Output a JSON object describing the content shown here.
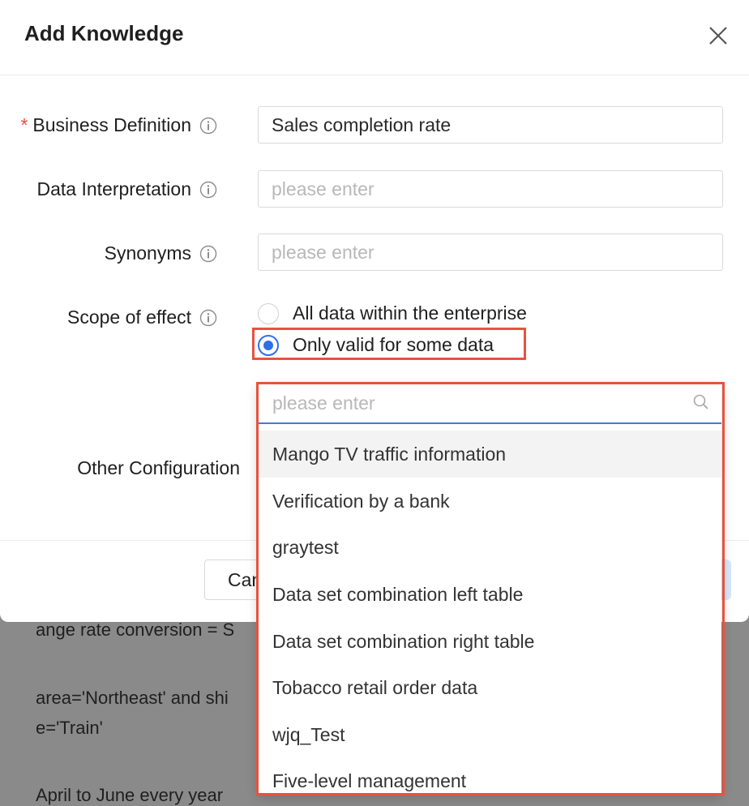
{
  "modal": {
    "title": "Add Knowledge",
    "close_icon": "close-icon"
  },
  "form": {
    "business_definition": {
      "label": "Business Definition",
      "required": true,
      "required_mark": "*",
      "value": "Sales completion rate"
    },
    "data_interpretation": {
      "label": "Data Interpretation",
      "placeholder": "please enter",
      "value": ""
    },
    "synonyms": {
      "label": "Synonyms",
      "placeholder": "please enter",
      "value": ""
    },
    "scope_of_effect": {
      "label": "Scope of effect",
      "options": [
        {
          "label": "All data within the enterprise",
          "checked": false
        },
        {
          "label": "Only valid for some data",
          "checked": true
        }
      ]
    },
    "other_configuration": {
      "label": "Other Configuration"
    }
  },
  "dataset_dropdown": {
    "search_placeholder": "please enter",
    "items": [
      "Mango TV traffic information",
      "Verification by a bank",
      "graytest",
      "Data set combination left table",
      "Data set combination right table",
      "Tobacco retail order data",
      "wjq_Test",
      "Five-level management"
    ],
    "active_index": 0
  },
  "footer": {
    "cancel_label": "Can"
  },
  "background_text": {
    "line1": "ange rate conversion = S",
    "line2": "area='Northeast' and shi",
    "line3": "e='Train'",
    "line4": "April to June every year"
  },
  "colors": {
    "accent": "#2f6fe8",
    "required": "#ef4b3e",
    "highlight": "#e8523f",
    "overlay": "#8a8a8a"
  }
}
